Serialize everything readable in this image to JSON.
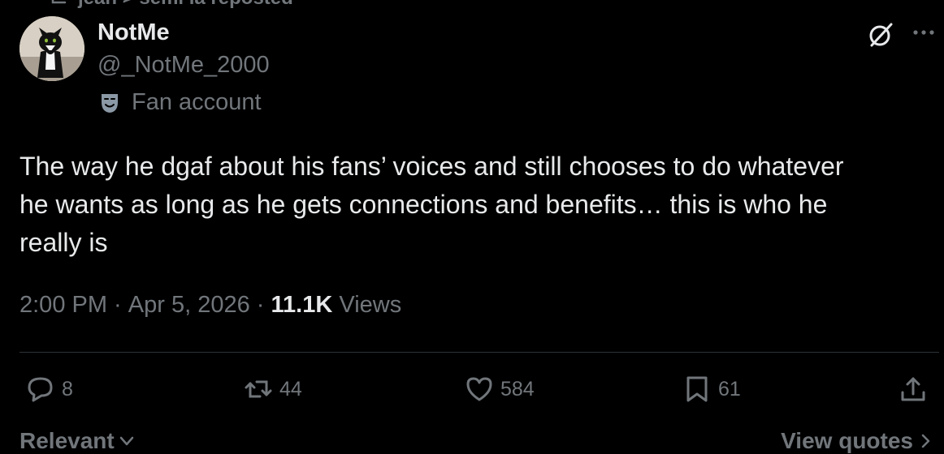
{
  "repost": {
    "text": "jean > semi la reposted",
    "icon": "repost-icon"
  },
  "author": {
    "name": "NotMe",
    "handle": "@_NotMe_2000",
    "label": "Fan account",
    "label_icon": "theater-mask-icon",
    "avatar_icon": "cat-avatar"
  },
  "header_icons": [
    "grok-icon",
    "more-icon"
  ],
  "tweet": {
    "text": "The way he dgaf about his fans’ voices and still chooses to do whatever\nhe wants as long as he gets connections and benefits… this is who he\nreally is"
  },
  "meta": {
    "time": "2:00 PM",
    "sep1": " · ",
    "date": "Apr 5, 2026",
    "sep2": " · ",
    "views_count": "11.1K",
    "views_label": " Views"
  },
  "actions": {
    "replies": "8",
    "reposts": "44",
    "likes": "584",
    "bookmarks": "61"
  },
  "footer": {
    "sort_label": "Relevant",
    "view_quotes": "View quotes"
  },
  "colors": {
    "background": "#000000",
    "primary_text": "#e7e9ea",
    "secondary_text": "#71767b",
    "divider": "#2f3336"
  }
}
